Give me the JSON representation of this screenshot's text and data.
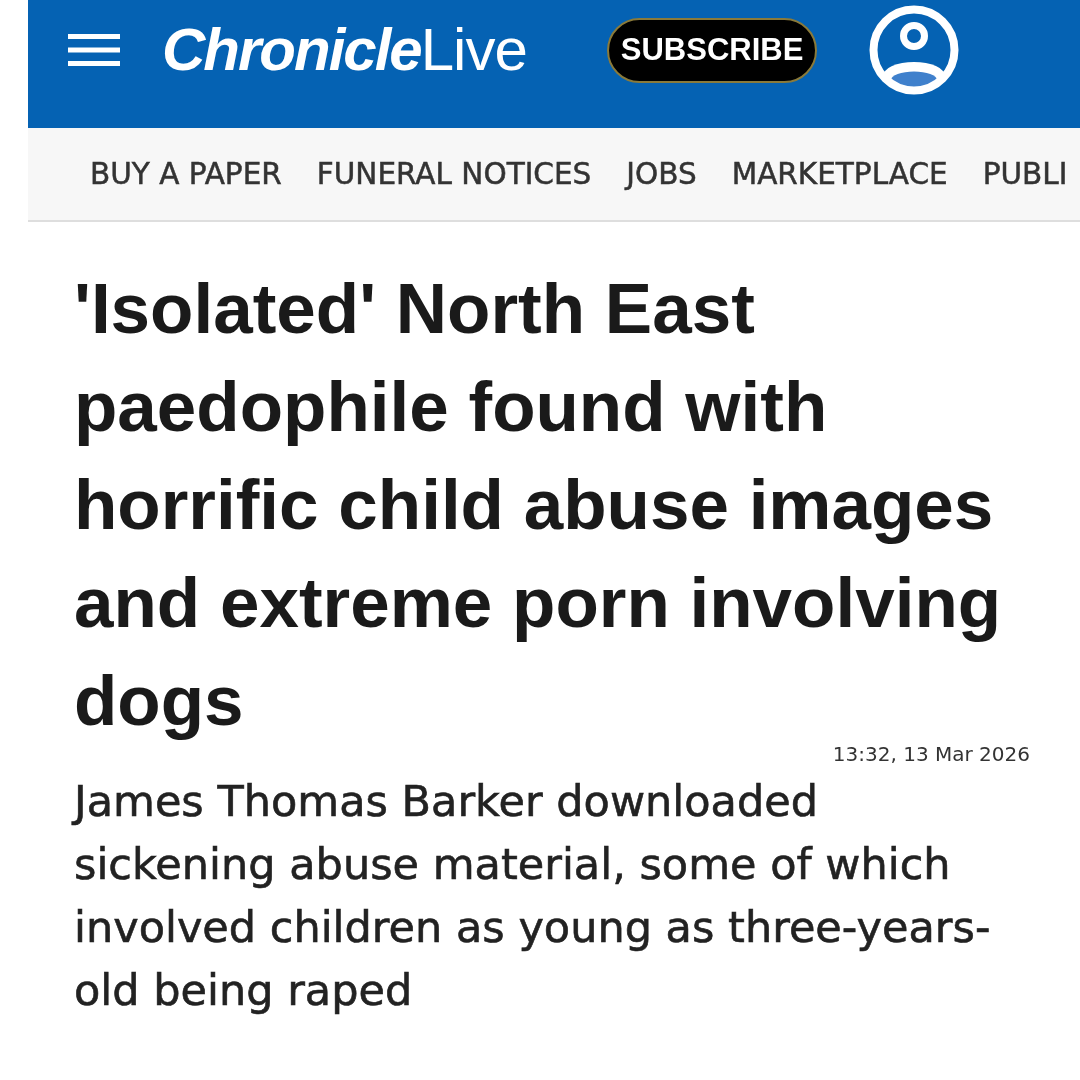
{
  "header": {
    "logo": "**Chronicle**Live",
    "subscribe_button": "SUBSCRIBE"
  },
  "nav": {
    "items": [
      "BUY A PAPER",
      "FUNERAL NOTICES",
      "JOBS",
      "MARKETPLACE",
      "PUBLI"
    ]
  },
  "article": {
    "headline": "'Isolated' North East paedophile found with horrific child abuse images and extreme porn involving dogs",
    "timestamp": "13:32, 13 Mar 2026",
    "standfirst": "James Thomas Barker downloaded sickening abuse material, some of which involved children as young as three-years-old being raped"
  }
}
